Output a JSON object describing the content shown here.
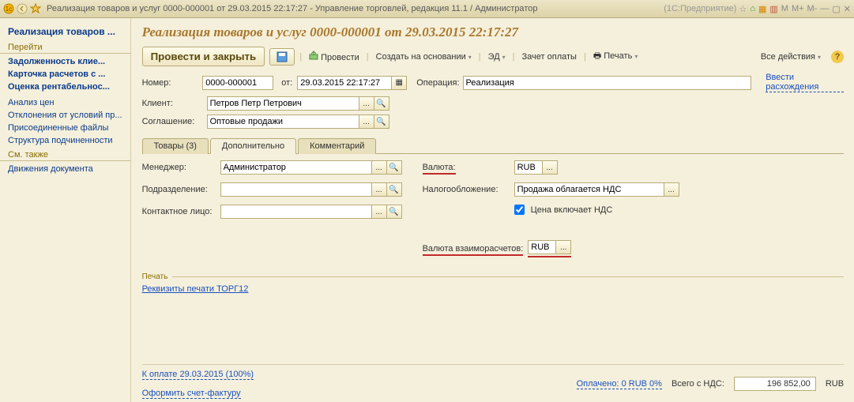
{
  "title": {
    "text": "Реализация товаров и услуг 0000-000001 от 29.03.2015 22:17:27 - Управление торговлей, редакция 11.1 / Администратор",
    "extra": "(1С:Предприятие)",
    "memory": [
      "M",
      "M+",
      "M-"
    ]
  },
  "sidebar": {
    "main_title": "Реализация товаров ...",
    "sec1": "Перейти",
    "links1": [
      "Задолженность клие...",
      "Карточка расчетов с ...",
      "Оценка рентабельнос..."
    ],
    "links2": [
      "Анализ цен",
      "Отклонения от условий пр...",
      "Присоединенные файлы",
      "Структура подчиненности"
    ],
    "sec2": "См. также",
    "links3": [
      "Движения документа"
    ]
  },
  "header": "Реализация товаров и услуг 0000-000001 от 29.03.2015 22:17:27",
  "toolbar": {
    "primary": "Провести и закрыть",
    "post": "Провести",
    "create": "Создать на основании",
    "ed": "ЭД",
    "offset": "Зачет оплаты",
    "print": "Печать",
    "all": "Все действия"
  },
  "top": {
    "num_label": "Номер:",
    "num": "0000-000001",
    "from": "от:",
    "date": "29.03.2015 22:17:27",
    "op_label": "Операция:",
    "op_value": "Реализация",
    "diff_link": "Ввести расхождения",
    "client_label": "Клиент:",
    "client": "Петров Петр Петрович",
    "agr_label": "Соглашение:",
    "agr": "Оптовые продажи"
  },
  "tabs": {
    "t1": "Товары (3)",
    "t2": "Дополнительно",
    "t3": "Комментарий"
  },
  "form": {
    "manager_label": "Менеджер:",
    "manager": "Администратор",
    "dept_label": "Подразделение:",
    "dept": "",
    "contact_label": "Контактное лицо:",
    "contact": "",
    "currency_label": "Валюта:",
    "currency": "RUB",
    "tax_label": "Налогообложение:",
    "tax": "Продажа облагается НДС",
    "vat_inc": "Цена включает НДС",
    "settle_label": "Валюта взаиморасчетов:",
    "settle": "RUB"
  },
  "print_sec": {
    "title": "Печать",
    "link": "Реквизиты печати ТОРГ12"
  },
  "footer": {
    "pay_link": "К оплате 29.03.2015 (100%)",
    "invoice_link": "Оформить счет-фактуру",
    "paid": "Оплачено: 0 RUB  0%",
    "total_label": "Всего с НДС:",
    "total": "196 852,00",
    "cur": "RUB"
  }
}
